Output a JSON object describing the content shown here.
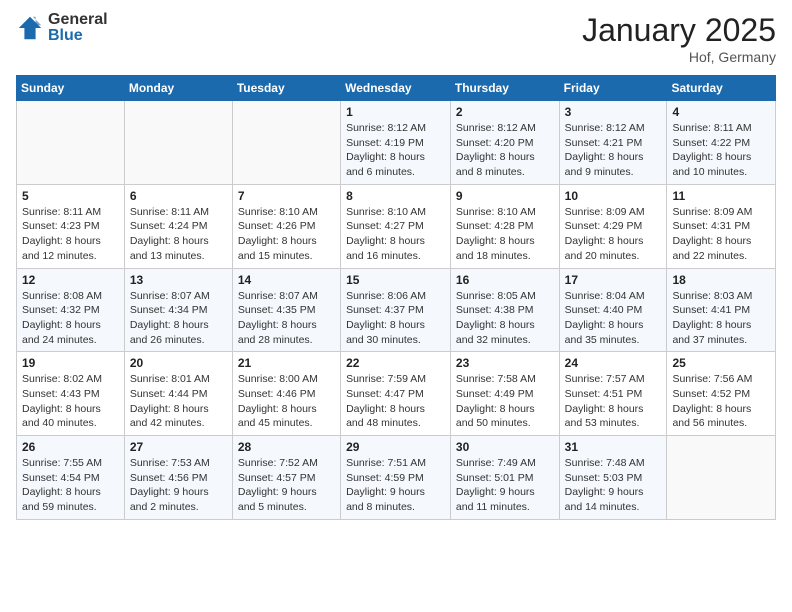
{
  "header": {
    "logo_general": "General",
    "logo_blue": "Blue",
    "month_title": "January 2025",
    "location": "Hof, Germany"
  },
  "days_of_week": [
    "Sunday",
    "Monday",
    "Tuesday",
    "Wednesday",
    "Thursday",
    "Friday",
    "Saturday"
  ],
  "weeks": [
    [
      {
        "day": "",
        "sunrise": "",
        "sunset": "",
        "daylight": ""
      },
      {
        "day": "",
        "sunrise": "",
        "sunset": "",
        "daylight": ""
      },
      {
        "day": "",
        "sunrise": "",
        "sunset": "",
        "daylight": ""
      },
      {
        "day": "1",
        "sunrise": "Sunrise: 8:12 AM",
        "sunset": "Sunset: 4:19 PM",
        "daylight": "Daylight: 8 hours and 6 minutes."
      },
      {
        "day": "2",
        "sunrise": "Sunrise: 8:12 AM",
        "sunset": "Sunset: 4:20 PM",
        "daylight": "Daylight: 8 hours and 8 minutes."
      },
      {
        "day": "3",
        "sunrise": "Sunrise: 8:12 AM",
        "sunset": "Sunset: 4:21 PM",
        "daylight": "Daylight: 8 hours and 9 minutes."
      },
      {
        "day": "4",
        "sunrise": "Sunrise: 8:11 AM",
        "sunset": "Sunset: 4:22 PM",
        "daylight": "Daylight: 8 hours and 10 minutes."
      }
    ],
    [
      {
        "day": "5",
        "sunrise": "Sunrise: 8:11 AM",
        "sunset": "Sunset: 4:23 PM",
        "daylight": "Daylight: 8 hours and 12 minutes."
      },
      {
        "day": "6",
        "sunrise": "Sunrise: 8:11 AM",
        "sunset": "Sunset: 4:24 PM",
        "daylight": "Daylight: 8 hours and 13 minutes."
      },
      {
        "day": "7",
        "sunrise": "Sunrise: 8:10 AM",
        "sunset": "Sunset: 4:26 PM",
        "daylight": "Daylight: 8 hours and 15 minutes."
      },
      {
        "day": "8",
        "sunrise": "Sunrise: 8:10 AM",
        "sunset": "Sunset: 4:27 PM",
        "daylight": "Daylight: 8 hours and 16 minutes."
      },
      {
        "day": "9",
        "sunrise": "Sunrise: 8:10 AM",
        "sunset": "Sunset: 4:28 PM",
        "daylight": "Daylight: 8 hours and 18 minutes."
      },
      {
        "day": "10",
        "sunrise": "Sunrise: 8:09 AM",
        "sunset": "Sunset: 4:29 PM",
        "daylight": "Daylight: 8 hours and 20 minutes."
      },
      {
        "day": "11",
        "sunrise": "Sunrise: 8:09 AM",
        "sunset": "Sunset: 4:31 PM",
        "daylight": "Daylight: 8 hours and 22 minutes."
      }
    ],
    [
      {
        "day": "12",
        "sunrise": "Sunrise: 8:08 AM",
        "sunset": "Sunset: 4:32 PM",
        "daylight": "Daylight: 8 hours and 24 minutes."
      },
      {
        "day": "13",
        "sunrise": "Sunrise: 8:07 AM",
        "sunset": "Sunset: 4:34 PM",
        "daylight": "Daylight: 8 hours and 26 minutes."
      },
      {
        "day": "14",
        "sunrise": "Sunrise: 8:07 AM",
        "sunset": "Sunset: 4:35 PM",
        "daylight": "Daylight: 8 hours and 28 minutes."
      },
      {
        "day": "15",
        "sunrise": "Sunrise: 8:06 AM",
        "sunset": "Sunset: 4:37 PM",
        "daylight": "Daylight: 8 hours and 30 minutes."
      },
      {
        "day": "16",
        "sunrise": "Sunrise: 8:05 AM",
        "sunset": "Sunset: 4:38 PM",
        "daylight": "Daylight: 8 hours and 32 minutes."
      },
      {
        "day": "17",
        "sunrise": "Sunrise: 8:04 AM",
        "sunset": "Sunset: 4:40 PM",
        "daylight": "Daylight: 8 hours and 35 minutes."
      },
      {
        "day": "18",
        "sunrise": "Sunrise: 8:03 AM",
        "sunset": "Sunset: 4:41 PM",
        "daylight": "Daylight: 8 hours and 37 minutes."
      }
    ],
    [
      {
        "day": "19",
        "sunrise": "Sunrise: 8:02 AM",
        "sunset": "Sunset: 4:43 PM",
        "daylight": "Daylight: 8 hours and 40 minutes."
      },
      {
        "day": "20",
        "sunrise": "Sunrise: 8:01 AM",
        "sunset": "Sunset: 4:44 PM",
        "daylight": "Daylight: 8 hours and 42 minutes."
      },
      {
        "day": "21",
        "sunrise": "Sunrise: 8:00 AM",
        "sunset": "Sunset: 4:46 PM",
        "daylight": "Daylight: 8 hours and 45 minutes."
      },
      {
        "day": "22",
        "sunrise": "Sunrise: 7:59 AM",
        "sunset": "Sunset: 4:47 PM",
        "daylight": "Daylight: 8 hours and 48 minutes."
      },
      {
        "day": "23",
        "sunrise": "Sunrise: 7:58 AM",
        "sunset": "Sunset: 4:49 PM",
        "daylight": "Daylight: 8 hours and 50 minutes."
      },
      {
        "day": "24",
        "sunrise": "Sunrise: 7:57 AM",
        "sunset": "Sunset: 4:51 PM",
        "daylight": "Daylight: 8 hours and 53 minutes."
      },
      {
        "day": "25",
        "sunrise": "Sunrise: 7:56 AM",
        "sunset": "Sunset: 4:52 PM",
        "daylight": "Daylight: 8 hours and 56 minutes."
      }
    ],
    [
      {
        "day": "26",
        "sunrise": "Sunrise: 7:55 AM",
        "sunset": "Sunset: 4:54 PM",
        "daylight": "Daylight: 8 hours and 59 minutes."
      },
      {
        "day": "27",
        "sunrise": "Sunrise: 7:53 AM",
        "sunset": "Sunset: 4:56 PM",
        "daylight": "Daylight: 9 hours and 2 minutes."
      },
      {
        "day": "28",
        "sunrise": "Sunrise: 7:52 AM",
        "sunset": "Sunset: 4:57 PM",
        "daylight": "Daylight: 9 hours and 5 minutes."
      },
      {
        "day": "29",
        "sunrise": "Sunrise: 7:51 AM",
        "sunset": "Sunset: 4:59 PM",
        "daylight": "Daylight: 9 hours and 8 minutes."
      },
      {
        "day": "30",
        "sunrise": "Sunrise: 7:49 AM",
        "sunset": "Sunset: 5:01 PM",
        "daylight": "Daylight: 9 hours and 11 minutes."
      },
      {
        "day": "31",
        "sunrise": "Sunrise: 7:48 AM",
        "sunset": "Sunset: 5:03 PM",
        "daylight": "Daylight: 9 hours and 14 minutes."
      },
      {
        "day": "",
        "sunrise": "",
        "sunset": "",
        "daylight": ""
      }
    ]
  ]
}
